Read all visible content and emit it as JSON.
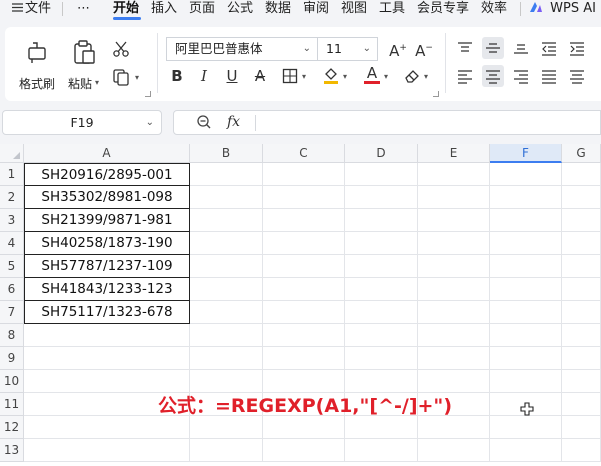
{
  "menu": {
    "items": [
      {
        "label": "文件",
        "x": 0
      },
      {
        "label": "⋯",
        "x": 0
      },
      {
        "label": "开始",
        "x": 0
      },
      {
        "label": "插入",
        "x": 0
      },
      {
        "label": "页面",
        "x": 0
      },
      {
        "label": "公式",
        "x": 0
      },
      {
        "label": "数据",
        "x": 0
      },
      {
        "label": "审阅",
        "x": 0
      },
      {
        "label": "视图",
        "x": 0
      },
      {
        "label": "工具",
        "x": 0
      },
      {
        "label": "会员专享",
        "x": 0
      },
      {
        "label": "效率",
        "x": 0
      }
    ],
    "hamburger_icon": "menu-icon",
    "wps_ai_label": "WPS AI"
  },
  "ribbon": {
    "format_painter_label": "格式刷",
    "paste_label": "粘贴",
    "font_name": "阿里巴巴普惠体",
    "font_size": "11",
    "bold_glyph": "B",
    "italic_glyph": "I",
    "underline_glyph": "U",
    "strike_glyph": "A",
    "font_color_glyph": "A",
    "increase_font_glyph": "A",
    "decrease_font_glyph": "A",
    "accent_color": "#e0202a",
    "fill_color": "#f2b800"
  },
  "formula_bar": {
    "name_box": "F19",
    "fx_label": "fx",
    "value": ""
  },
  "sheet": {
    "columns": [
      "A",
      "B",
      "C",
      "D",
      "E",
      "F",
      "G"
    ],
    "selected_column": "F",
    "rows": [
      "1",
      "2",
      "3",
      "4",
      "5",
      "6",
      "7",
      "8",
      "9",
      "10",
      "11",
      "12",
      "13"
    ],
    "column_a_values": [
      "SH20916/2895-001",
      "SH35302/8981-098",
      "SH21399/9871-981",
      "SH40258/1873-190",
      "SH57787/1237-109",
      "SH41843/1233-123",
      "SH75117/1323-678"
    ],
    "formula_note": "公式：=REGEXP(A1,\"[^-/]+\")",
    "selection_color": "#3c7df0"
  }
}
